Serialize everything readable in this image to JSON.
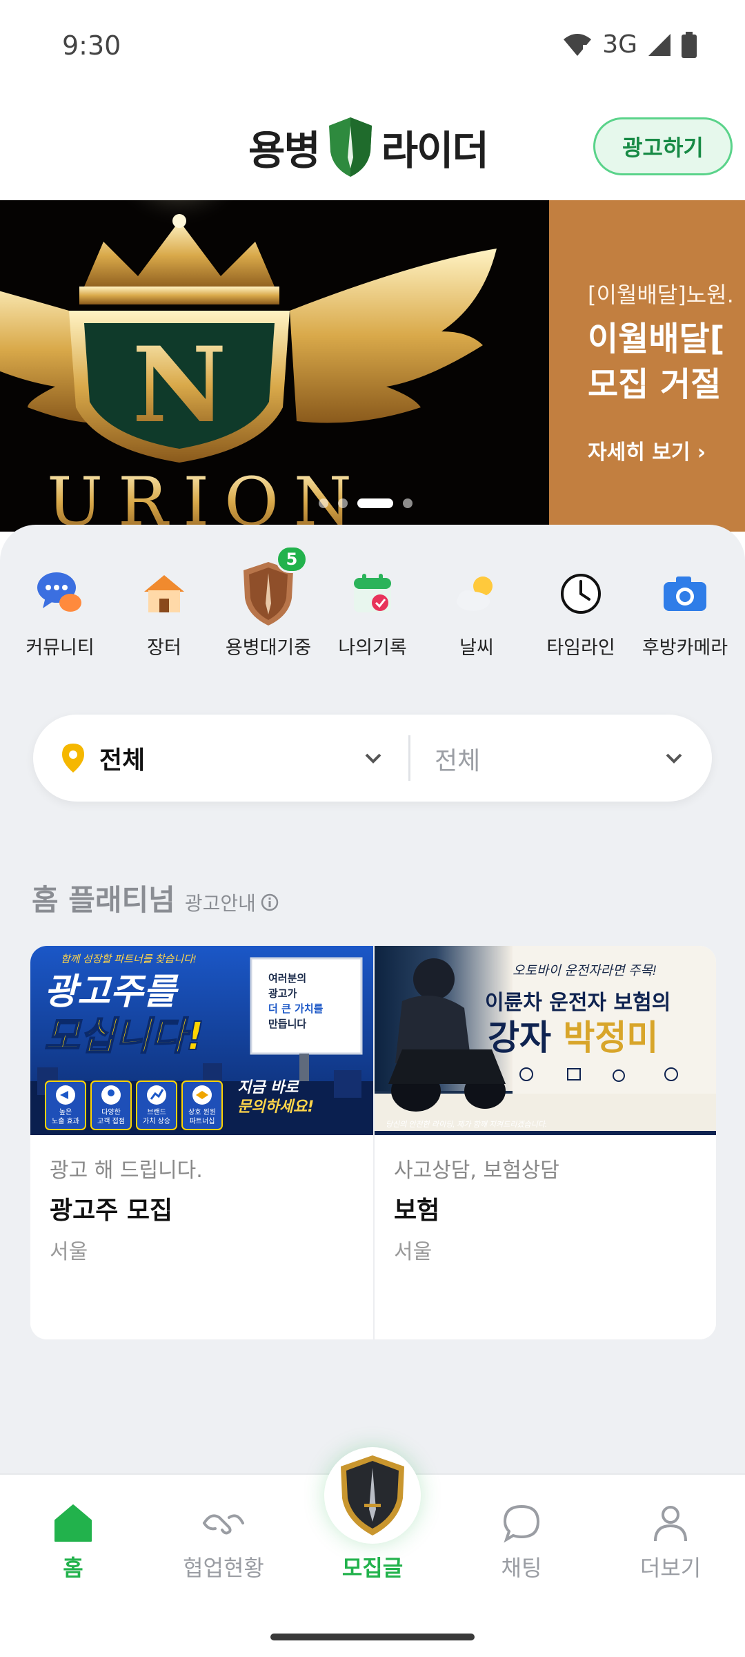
{
  "status_bar": {
    "time": "9:30",
    "network": "3G"
  },
  "header": {
    "logo_left": "용병",
    "logo_right": "라이더",
    "ad_button": "광고하기"
  },
  "banner": {
    "slide1_text": "URION",
    "slide2": {
      "subtitle": "[이월배달]노원.",
      "title": "이월배달[\n모집 거절",
      "more": "자세히 보기 ›"
    }
  },
  "quick_menu": [
    {
      "label": "커뮤니티",
      "icon": "community-chat-icon"
    },
    {
      "label": "장터",
      "icon": "market-house-icon"
    },
    {
      "label": "용병대기중",
      "icon": "shield-icon",
      "badge": "5"
    },
    {
      "label": "나의기록",
      "icon": "calendar-icon"
    },
    {
      "label": "날씨",
      "icon": "weather-icon"
    },
    {
      "label": "타임라인",
      "icon": "clock-icon"
    },
    {
      "label": "후방카메라",
      "icon": "camera-icon"
    }
  ],
  "filter": {
    "region": "전체",
    "sub_region": "전체"
  },
  "section": {
    "title": "홈 플래티넘",
    "ad_info": "광고안내"
  },
  "cards": [
    {
      "image": {
        "top": "함께 성장할 파트너를 찾습니다!",
        "line1": "광고주를",
        "line2": "모십니다!",
        "board": "여러분의\n광고가\n더 큰 가치를\n만듭니다",
        "cta": "지금 바로\n문의하세요!",
        "features": [
          "높은\n노출 효과",
          "다양한\n고객 접점",
          "브랜드\n가치 상승",
          "상호 윈윈\n파트너십"
        ]
      },
      "category": "광고 해 드립니다.",
      "title": "광고주 모집",
      "location": "서울"
    },
    {
      "image": {
        "top": "오토바이 운전자라면 주목!",
        "line1": "이륜차 운전자 보험의",
        "line2a": "강자 ",
        "line2b": "박정미",
        "bottom": "당신의 안전한 라이딩, 제가 함께 지켜드리겠습니다."
      },
      "category": "사고상담, 보험상담",
      "title": "보험",
      "location": "서울"
    }
  ],
  "bottom_nav": {
    "home": "홈",
    "collab": "협업현황",
    "recruit": "모집글",
    "chat": "채팅",
    "more": "더보기"
  },
  "colors": {
    "accent_green": "#22b24c",
    "banner_orange": "#c27f40",
    "sheet_bg": "#eef0f3"
  }
}
